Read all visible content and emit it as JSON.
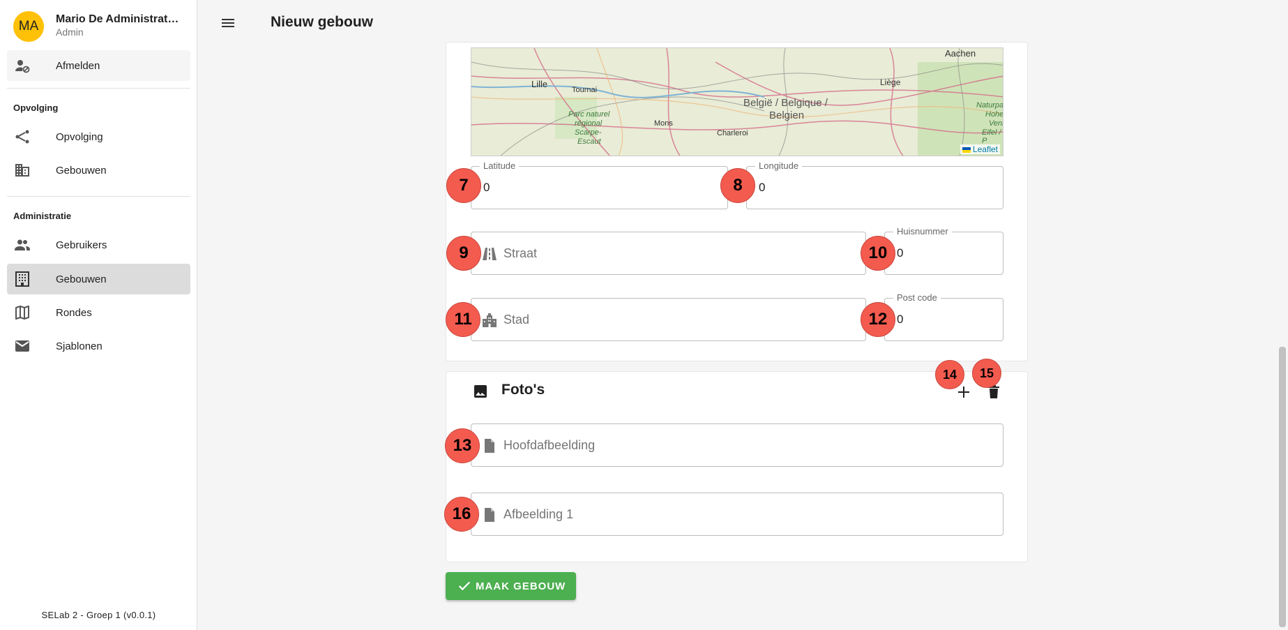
{
  "user": {
    "initials": "MA",
    "name": "Mario De Administrat…",
    "role": "Admin"
  },
  "sidebar": {
    "logout": "Afmelden",
    "section_opvolging": "Opvolging",
    "opvolging_items": [
      {
        "label": "Opvolging",
        "icon": "route-icon"
      },
      {
        "label": "Gebouwen",
        "icon": "business-icon"
      }
    ],
    "section_admin": "Administratie",
    "admin_items": [
      {
        "label": "Gebruikers",
        "icon": "people-icon"
      },
      {
        "label": "Gebouwen",
        "icon": "apartment-icon"
      },
      {
        "label": "Rondes",
        "icon": "map-icon"
      },
      {
        "label": "Sjablonen",
        "icon": "mail-icon"
      }
    ],
    "footer": "SELab 2 - Groep 1 (v0.0.1)"
  },
  "header": {
    "title": "Nieuw gebouw"
  },
  "map": {
    "attribution": "Leaflet",
    "labels": [
      "Aachen",
      "Lille",
      "Tournai",
      "Liège",
      "België / Belgique /",
      "Belgien",
      "Mons",
      "Charleroi",
      "Parc naturel",
      "régional",
      "Scarpe-",
      "Escaut",
      "Naturpa",
      "Hohe",
      "Venn",
      "Eifel / P"
    ]
  },
  "location": {
    "latitude": {
      "label": "Latitude",
      "value": "0",
      "marker": "7"
    },
    "longitude": {
      "label": "Longitude",
      "value": "0",
      "marker": "8"
    },
    "street": {
      "placeholder": "Straat",
      "marker": "9"
    },
    "house_number": {
      "label": "Huisnummer",
      "value": "0",
      "marker": "10"
    },
    "city": {
      "placeholder": "Stad",
      "marker": "11"
    },
    "postal_code": {
      "label": "Post code",
      "value": "0",
      "marker": "12"
    }
  },
  "photos": {
    "title": "Foto's",
    "add_marker": "14",
    "delete_marker": "15",
    "main_image": {
      "placeholder": "Hoofdafbeelding",
      "marker": "13"
    },
    "image_1": {
      "placeholder": "Afbeelding 1",
      "marker": "16"
    }
  },
  "submit": {
    "label": "MAAK GEBOUW"
  },
  "colors": {
    "accent": "#4caf50",
    "avatar": "#ffc107",
    "marker": "#f45b4f"
  }
}
